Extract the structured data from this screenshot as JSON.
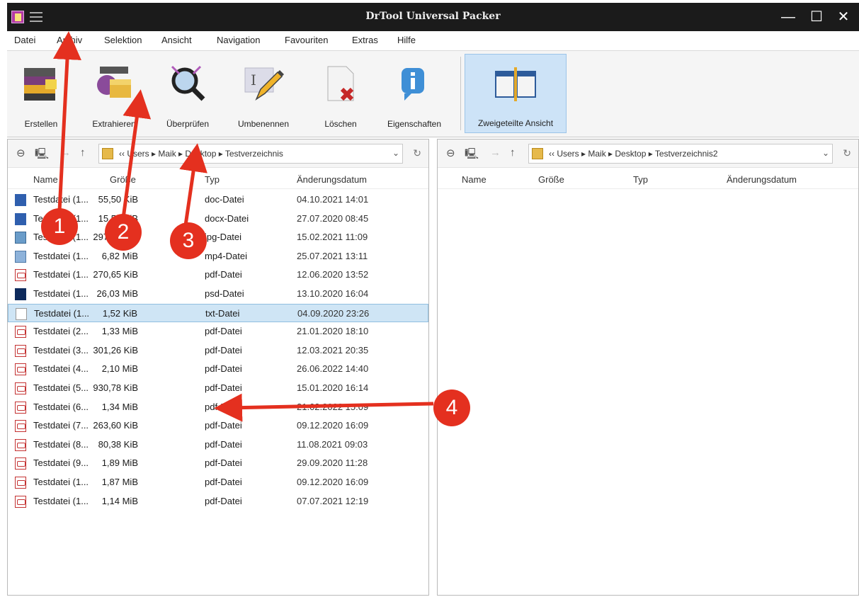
{
  "window": {
    "title": "DrTool Universal Packer",
    "minimize": "—",
    "maximize": "☐",
    "close": "✕"
  },
  "menu": [
    "Datei",
    "Archiv",
    "Selektion",
    "Ansicht",
    "Navigation",
    "Favouriten",
    "Extras",
    "Hilfe"
  ],
  "ribbon": {
    "create": "Erstellen",
    "extract": "Extrahieren",
    "verify": "Überprüfen",
    "rename": "Umbenennen",
    "delete": "Löschen",
    "properties": "Eigenschaften",
    "split_view": "Zweigeteilte Ansicht"
  },
  "left_pane": {
    "breadcrumb": "‹‹ Users  ▸  Maik  ▸  Desktop  ▸  Testverzeichnis",
    "columns": {
      "name": "Name",
      "size": "Größe",
      "type": "Typ",
      "date": "Änderungsdatum"
    },
    "files": [
      {
        "name": "Testdatei (1...",
        "size": "55,50 KiB",
        "type": "doc-Datei",
        "date": "04.10.2021 14:01",
        "icon": "doc"
      },
      {
        "name": "Testdatei (1...",
        "size": "15,50 KiB",
        "type": "docx-Datei",
        "date": "27.07.2020 08:45",
        "icon": "doc"
      },
      {
        "name": "Testdatei (1...",
        "size": "297,00 KiB",
        "type": "jpg-Datei",
        "date": "15.02.2021 11:09",
        "icon": "img"
      },
      {
        "name": "Testdatei (1...",
        "size": "6,82 MiB",
        "type": "mp4-Datei",
        "date": "25.07.2021 13:11",
        "icon": "mp4"
      },
      {
        "name": "Testdatei (1...",
        "size": "270,65 KiB",
        "type": "pdf-Datei",
        "date": "12.06.2020 13:52",
        "icon": "pdf"
      },
      {
        "name": "Testdatei (1...",
        "size": "26,03 MiB",
        "type": "psd-Datei",
        "date": "13.10.2020 16:04",
        "icon": "psd"
      },
      {
        "name": "Testdatei (1...",
        "size": "1,52 KiB",
        "type": "txt-Datei",
        "date": "04.09.2020 23:26",
        "icon": "txt"
      },
      {
        "name": "Testdatei (2...",
        "size": "1,33 MiB",
        "type": "pdf-Datei",
        "date": "21.01.2020 18:10",
        "icon": "pdf"
      },
      {
        "name": "Testdatei (3...",
        "size": "301,26 KiB",
        "type": "pdf-Datei",
        "date": "12.03.2021 20:35",
        "icon": "pdf"
      },
      {
        "name": "Testdatei (4...",
        "size": "2,10 MiB",
        "type": "pdf-Datei",
        "date": "26.06.2022 14:40",
        "icon": "pdf"
      },
      {
        "name": "Testdatei (5...",
        "size": "930,78 KiB",
        "type": "pdf-Datei",
        "date": "15.01.2020 16:14",
        "icon": "pdf"
      },
      {
        "name": "Testdatei (6...",
        "size": "1,34 MiB",
        "type": "pdf-Datei",
        "date": "21.02.2022 15:09",
        "icon": "pdf"
      },
      {
        "name": "Testdatei (7...",
        "size": "263,60 KiB",
        "type": "pdf-Datei",
        "date": "09.12.2020 16:09",
        "icon": "pdf"
      },
      {
        "name": "Testdatei (8...",
        "size": "80,38 KiB",
        "type": "pdf-Datei",
        "date": "11.08.2021 09:03",
        "icon": "pdf"
      },
      {
        "name": "Testdatei (9...",
        "size": "1,89 MiB",
        "type": "pdf-Datei",
        "date": "29.09.2020 11:28",
        "icon": "pdf"
      },
      {
        "name": "Testdatei (1...",
        "size": "1,87 MiB",
        "type": "pdf-Datei",
        "date": "09.12.2020 16:09",
        "icon": "pdf"
      },
      {
        "name": "Testdatei (1...",
        "size": "1,14 MiB",
        "type": "pdf-Datei",
        "date": "07.07.2021 12:19",
        "icon": "pdf"
      }
    ],
    "selected_index": 6
  },
  "right_pane": {
    "breadcrumb": "‹‹ Users  ▸  Maik  ▸  Desktop  ▸  Testverzeichnis2",
    "columns": {
      "name": "Name",
      "size": "Größe",
      "type": "Typ",
      "date": "Änderungsdatum"
    }
  },
  "annotations": {
    "badge1": "1",
    "badge2": "2",
    "badge3": "3",
    "badge4": "4",
    "color": "#e4301f"
  },
  "nav_glyphs": {
    "back": "⊖",
    "computer": "🖳",
    "forward": "→",
    "up": "↑",
    "dropdown": "⌄",
    "refresh": "↻"
  }
}
